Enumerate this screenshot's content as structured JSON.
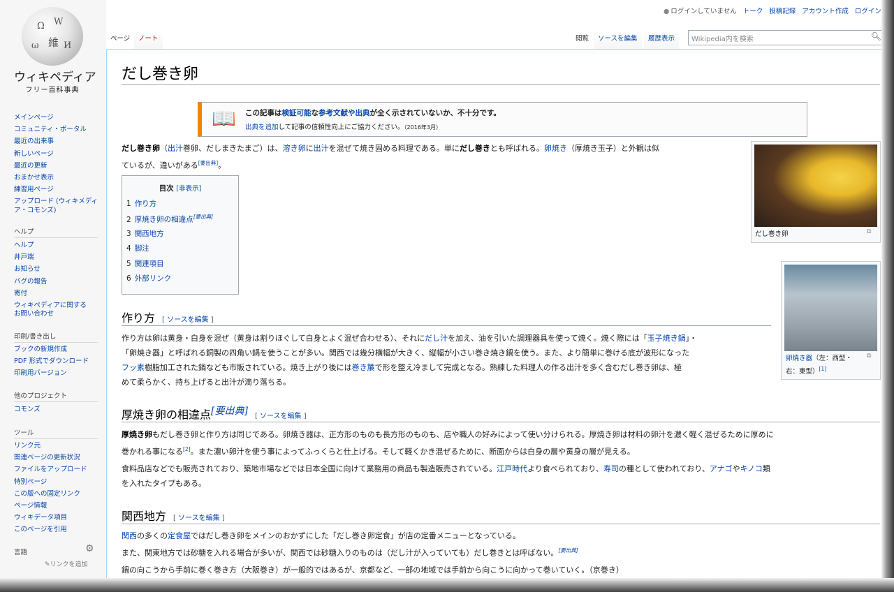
{
  "logo": {
    "title": "ウィキペディア",
    "subtitle": "フリー百科事典"
  },
  "nav_main": [
    "メインページ",
    "コミュニティ・ポータル",
    "最近の出来事",
    "新しいページ",
    "最近の更新",
    "おまかせ表示",
    "練習用ページ",
    "アップロード (ウィキメディ",
    "ア・コモンズ)"
  ],
  "help": {
    "heading": "ヘルプ",
    "items": [
      "ヘルプ",
      "井戸端",
      "お知らせ",
      "バグの報告",
      "寄付",
      "ウィキペディアに関する",
      "お問い合わせ"
    ]
  },
  "print": {
    "heading": "印刷/書き出し",
    "items": [
      "ブックの新規作成",
      "PDF 形式でダウンロード",
      "印刷用バージョン"
    ]
  },
  "other_projects": {
    "heading": "他のプロジェクト",
    "items": [
      "コモンズ"
    ]
  },
  "tools": {
    "heading": "ツール",
    "items": [
      "リンク元",
      "関連ページの更新状況",
      "ファイルをアップロード",
      "特別ページ",
      "この版への固定リンク",
      "ページ情報",
      "ウィキデータ項目",
      "このページを引用"
    ]
  },
  "languages": {
    "heading": "言語",
    "add_link": "リンクを追加"
  },
  "personal": {
    "not_logged_in": "ログインしていません",
    "talk": "トーク",
    "contribs": "投稿記録",
    "create_account": "アカウント作成",
    "login": "ログイン"
  },
  "tabs": {
    "page": "ページ",
    "talk": "ノート",
    "read": "閲覧",
    "edit_source": "ソースを編集",
    "history": "履歴表示"
  },
  "search": {
    "placeholder": "Wikipedia内を検索"
  },
  "article": {
    "title": "だし巻き卵",
    "notice": {
      "line1": [
        "この記事は",
        "検証可能",
        "な",
        "参考文献や出典",
        "が全く示されていないか、不十分です。"
      ],
      "line2": [
        "出典を追加",
        "して記事の信頼性向上にご協力ください。",
        "（2016年3月）"
      ]
    },
    "intro": {
      "line1": [
        "だし巻き卵",
        "（",
        "出汁",
        "巻卵、だしまきたまご）は、",
        "溶き卵",
        "に",
        "出汁",
        "を混ぜて焼き固める料理である。単に",
        "だし巻き",
        "とも呼ばれる。",
        "卵焼き",
        "（厚焼き玉子）と外観は似"
      ],
      "line2": [
        "ているが、違いがある",
        "[要出典]",
        "。"
      ]
    },
    "toc": {
      "title": "目次",
      "toggle": "[非表示]",
      "items": [
        {
          "num": "1",
          "label": "作り方"
        },
        {
          "num": "2",
          "label": "厚焼き卵の相違点",
          "sup": "[要出典]"
        },
        {
          "num": "3",
          "label": "関西地方"
        },
        {
          "num": "4",
          "label": "脚注"
        },
        {
          "num": "5",
          "label": "関連項目"
        },
        {
          "num": "6",
          "label": "外部リンク"
        }
      ]
    },
    "image1": {
      "caption": "だし巻き卵"
    },
    "image2": {
      "caption_link": "卵焼き器",
      "caption_rest": "（左：西型・",
      "caption_line2": "右：東型）",
      "sup": "[1]"
    },
    "edit_label": "[ ソースを編集 ]",
    "sec1": {
      "heading": "作り方",
      "l1": [
        "作り方は卵は黄身・白身を混ぜ（黄身は割りほぐして白身とよく混ぜ合わせる）、それに",
        "だし汁",
        "を加え、油を引いた調理器具を使って焼く。焼く際には「",
        "玉子焼き鍋",
        "」・"
      ],
      "l2": "「卵焼き器」と呼ばれる銅製の四角い鍋を使うことが多い。関西では幾分横幅が大きく、縦幅が小さい巻き焼き鍋を使う。また、より簡単に巻ける底が波形になった",
      "l3": [
        "フッ素",
        "樹脂加工された鍋なども市販されている。焼き上がり後には",
        "巻き簾",
        "で形を整え冷まして完成となる。熟練した料理人の作る出汁を多く含むだし巻き卵は、極"
      ],
      "l4": "めて柔らかく、持ち上げると出汁が滴り落ちる。"
    },
    "sec2": {
      "heading": "厚焼き卵の相違点",
      "heading_sup": "[要出典]",
      "l1": [
        "厚焼き卵",
        "もだし巻き卵と作り方は同じである。卵焼き器は、正方形のものも長方形のものも、店や職人の好みによって使い分けられる。厚焼き卵は材料の卵汁を濃く軽く混ぜるために厚めに"
      ],
      "l2": [
        "巻かれる事になる",
        "[2]",
        "。また濃い卵汁を使う事によってふっくらと仕上げる。そして軽くかき混ぜるために、断面からは白身の層や黄身の層が見える。"
      ],
      "l3": [
        "食料品店などでも販売されており、築地市場などでは日本全国に向けて業務用の商品も製造販売されている。",
        "江戸時代",
        "より食べられており、",
        "寿司",
        "の種として使われており、",
        "アナゴ",
        "や",
        "キノコ",
        "類"
      ],
      "l4": "を入れたタイプもある。"
    },
    "sec3": {
      "heading": "関西地方",
      "l1": [
        "関西",
        "の多くの",
        "定食屋",
        "ではだし巻き卵をメインのおかずにした「だし巻き卵定食」が店の定番メニューとなっている。"
      ],
      "l2": [
        "また、関東地方では砂糖を入れる場合が多いが、関西では砂糖入りのものは（だし汁が入っていても）だし巻きとは呼ばない。",
        "[要出典]"
      ],
      "l3": "鍋の向こうから手前に巻く巻き方（大阪巻き）が一般的ではあるが、京都など、一部の地域では手前から向こうに向かって巻いていく。（京巻き）"
    }
  },
  "colors": {
    "link": "#0645ad",
    "redlink": "#ba0000",
    "notice_border": "#f28500",
    "sidebar_bg": "#f6f6f6",
    "tab_border": "#a7d7f9"
  }
}
